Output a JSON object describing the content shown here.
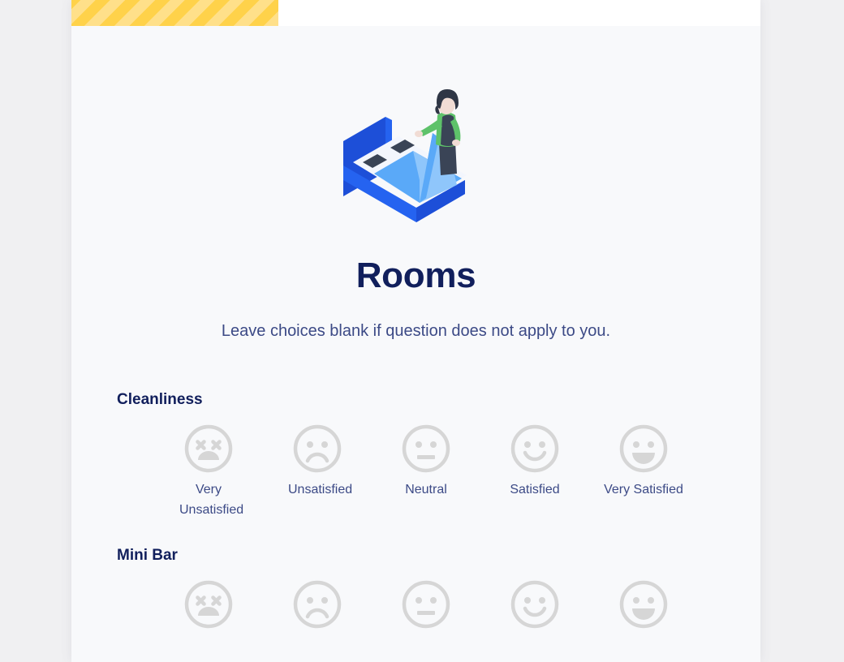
{
  "page": {
    "background_color": "#f0f0f2",
    "card_background": "#ffffff",
    "panel_background": "#f8f9fb"
  },
  "progress": {
    "name": "survey-progress-bar",
    "percent": 30,
    "fill_color": "#ffd24a",
    "stripe_color": "#ffe08a"
  },
  "illustration": {
    "name": "housekeeping-bed-illustration",
    "colors": {
      "bed_frame": "#2563f0",
      "bed_frame_dark": "#1d4fd8",
      "blanket": "#5aa9f8",
      "blanket_light": "#8fc6fb",
      "mattress": "#f3f6fd",
      "pillow": "#3a4456",
      "shirt": "#5ec26a",
      "apron": "#3a4456",
      "hair": "#2f3645",
      "skin": "#f1dcd4"
    }
  },
  "header": {
    "title": "Rooms",
    "subtitle": "Leave choices blank if question does not apply to you.",
    "title_color": "#111f5c",
    "subtitle_color": "#3c4a86"
  },
  "scale": {
    "icon_color": "#d6d6d6",
    "options": [
      {
        "label": "Very Unsatisfied",
        "icon": "face-very-unsatisfied-icon",
        "value": 1
      },
      {
        "label": "Unsatisfied",
        "icon": "face-unsatisfied-icon",
        "value": 2
      },
      {
        "label": "Neutral",
        "icon": "face-neutral-icon",
        "value": 3
      },
      {
        "label": "Satisfied",
        "icon": "face-satisfied-icon",
        "value": 4
      },
      {
        "label": "Very Satisfied",
        "icon": "face-very-satisfied-icon",
        "value": 5
      }
    ]
  },
  "questions": [
    {
      "label": "Cleanliness",
      "selected": null
    },
    {
      "label": "Mini Bar",
      "selected": null
    }
  ]
}
